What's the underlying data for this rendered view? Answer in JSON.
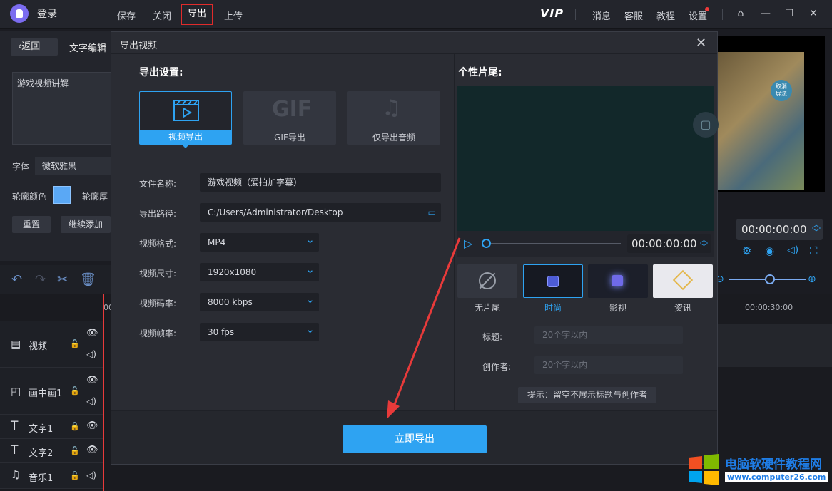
{
  "topbar": {
    "login": "登录",
    "menu": [
      "保存",
      "关闭",
      "导出",
      "上传"
    ],
    "vip": "VIP",
    "right_menu": [
      "消息",
      "客服",
      "教程",
      "设置"
    ]
  },
  "left_panel": {
    "back": "返回",
    "tab": "文字编辑",
    "text_content": "游戏视频讲解",
    "font_label": "字体",
    "font_value": "微软雅黑",
    "outline_color_label": "轮廓颜色",
    "outline_thickness_label": "轮廓厚",
    "reset": "重置",
    "continue_add": "继续添加"
  },
  "tracks": [
    "视频",
    "画中画1",
    "文字1",
    "文字2",
    "音乐1"
  ],
  "timeline": {
    "ruler_start": "00",
    "ruler_mark": "00:00:30:00"
  },
  "preview": {
    "timecode": "00:00:00:00",
    "overlay_btn": "取消\n屏法"
  },
  "dialog": {
    "title": "导出视频",
    "export_settings": "导出设置:",
    "modes": [
      {
        "label": "视频导出",
        "icon": "video-clapper-icon",
        "active": true
      },
      {
        "label": "GIF导出",
        "icon": "gif-icon",
        "active": false
      },
      {
        "label": "仅导出音频",
        "icon": "music-note-icon",
        "active": false
      }
    ],
    "form": {
      "filename_label": "文件名称:",
      "filename_value": "游戏视频（爱拍加字幕）",
      "path_label": "导出路径:",
      "path_value": "C:/Users/Administrator/Desktop",
      "format_label": "视频格式:",
      "format_value": "MP4",
      "size_label": "视频尺寸:",
      "size_value": "1920x1080",
      "bitrate_label": "视频码率:",
      "bitrate_value": "8000 kbps",
      "fps_label": "视频帧率:",
      "fps_value": "30 fps"
    },
    "outro_title": "个性片尾:",
    "timecode": "00:00:00:00",
    "templates": [
      {
        "label": "无片尾",
        "active": false
      },
      {
        "label": "时尚",
        "active": true
      },
      {
        "label": "影视",
        "active": false
      },
      {
        "label": "资讯",
        "active": false
      }
    ],
    "title_label": "标题:",
    "title_placeholder": "20个字以内",
    "author_label": "创作者:",
    "author_placeholder": "20个字以内",
    "tip": "提示：留空不展示标题与创作者",
    "export_now": "立即导出"
  },
  "watermark": {
    "name": "电脑软硬件教程网",
    "url": "www.computer26.com"
  },
  "colors": {
    "accent": "#2ea3f2",
    "highlight_red": "#e02b2b",
    "bg": "#1b1c22"
  }
}
